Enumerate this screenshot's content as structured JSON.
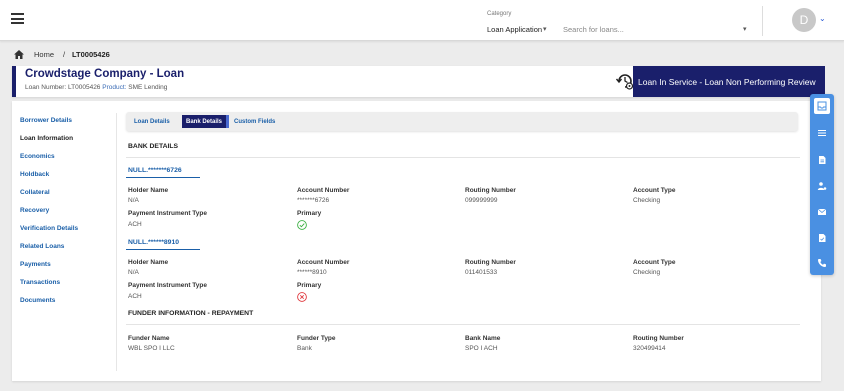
{
  "topbar": {
    "category_label": "Category",
    "category_value": "Loan Application",
    "search_placeholder": "Search for loans...",
    "avatar_initial": "D"
  },
  "breadcrumb": {
    "home": "Home",
    "separator": "/",
    "current": "LT0005426"
  },
  "header": {
    "title": "Crowdstage Company - Loan",
    "loan_number_label": "Loan Number:",
    "loan_number": "LT0005426",
    "product_label": "Product:",
    "product": "SME Lending",
    "status": "Loan In Service - Loan Non Performing Review"
  },
  "sidebar": {
    "items": [
      {
        "label": "Borrower Details"
      },
      {
        "label": "Loan Information"
      },
      {
        "label": "Economics"
      },
      {
        "label": "Holdback"
      },
      {
        "label": "Collateral"
      },
      {
        "label": "Recovery"
      },
      {
        "label": "Verification Details"
      },
      {
        "label": "Related Loans"
      },
      {
        "label": "Payments"
      },
      {
        "label": "Transactions"
      },
      {
        "label": "Documents"
      }
    ]
  },
  "tabs": [
    {
      "label": "Loan Details"
    },
    {
      "label": "Bank Details"
    },
    {
      "label": "Custom Fields"
    }
  ],
  "bank_details": {
    "section_title": "BANK DETAILS",
    "labels": {
      "holder_name": "Holder Name",
      "account_number": "Account Number",
      "routing_number": "Routing Number",
      "account_type": "Account Type",
      "payment_instrument_type": "Payment Instrument Type",
      "primary": "Primary"
    },
    "accounts": [
      {
        "title": "NULL.*******6726",
        "holder_name": "N/A",
        "account_number": "*******6726",
        "routing_number": "099999999",
        "account_type": "Checking",
        "payment_instrument_type": "ACH",
        "primary": true
      },
      {
        "title": "NULL.******8910",
        "holder_name": "N/A",
        "account_number": "******8910",
        "routing_number": "011401533",
        "account_type": "Checking",
        "payment_instrument_type": "ACH",
        "primary": false
      }
    ]
  },
  "funder": {
    "section_title": "FUNDER INFORMATION - REPAYMENT",
    "labels": {
      "funder_name": "Funder Name",
      "funder_type": "Funder Type",
      "bank_name": "Bank Name",
      "routing_number": "Routing Number"
    },
    "funder_name": "WBL SPO I LLC",
    "funder_type": "Bank",
    "bank_name": "SPO I ACH",
    "routing_number": "320499414"
  },
  "colors": {
    "primary_navy": "#1a1f6b",
    "link_blue": "#1a5fa8",
    "rail_blue": "#4a90e2",
    "success": "#3cb043",
    "error": "#e0393e"
  },
  "right_rail_icons": [
    "inbox-icon",
    "list-icon",
    "document-icon",
    "people-icon",
    "mail-icon",
    "note-icon",
    "phone-icon"
  ]
}
